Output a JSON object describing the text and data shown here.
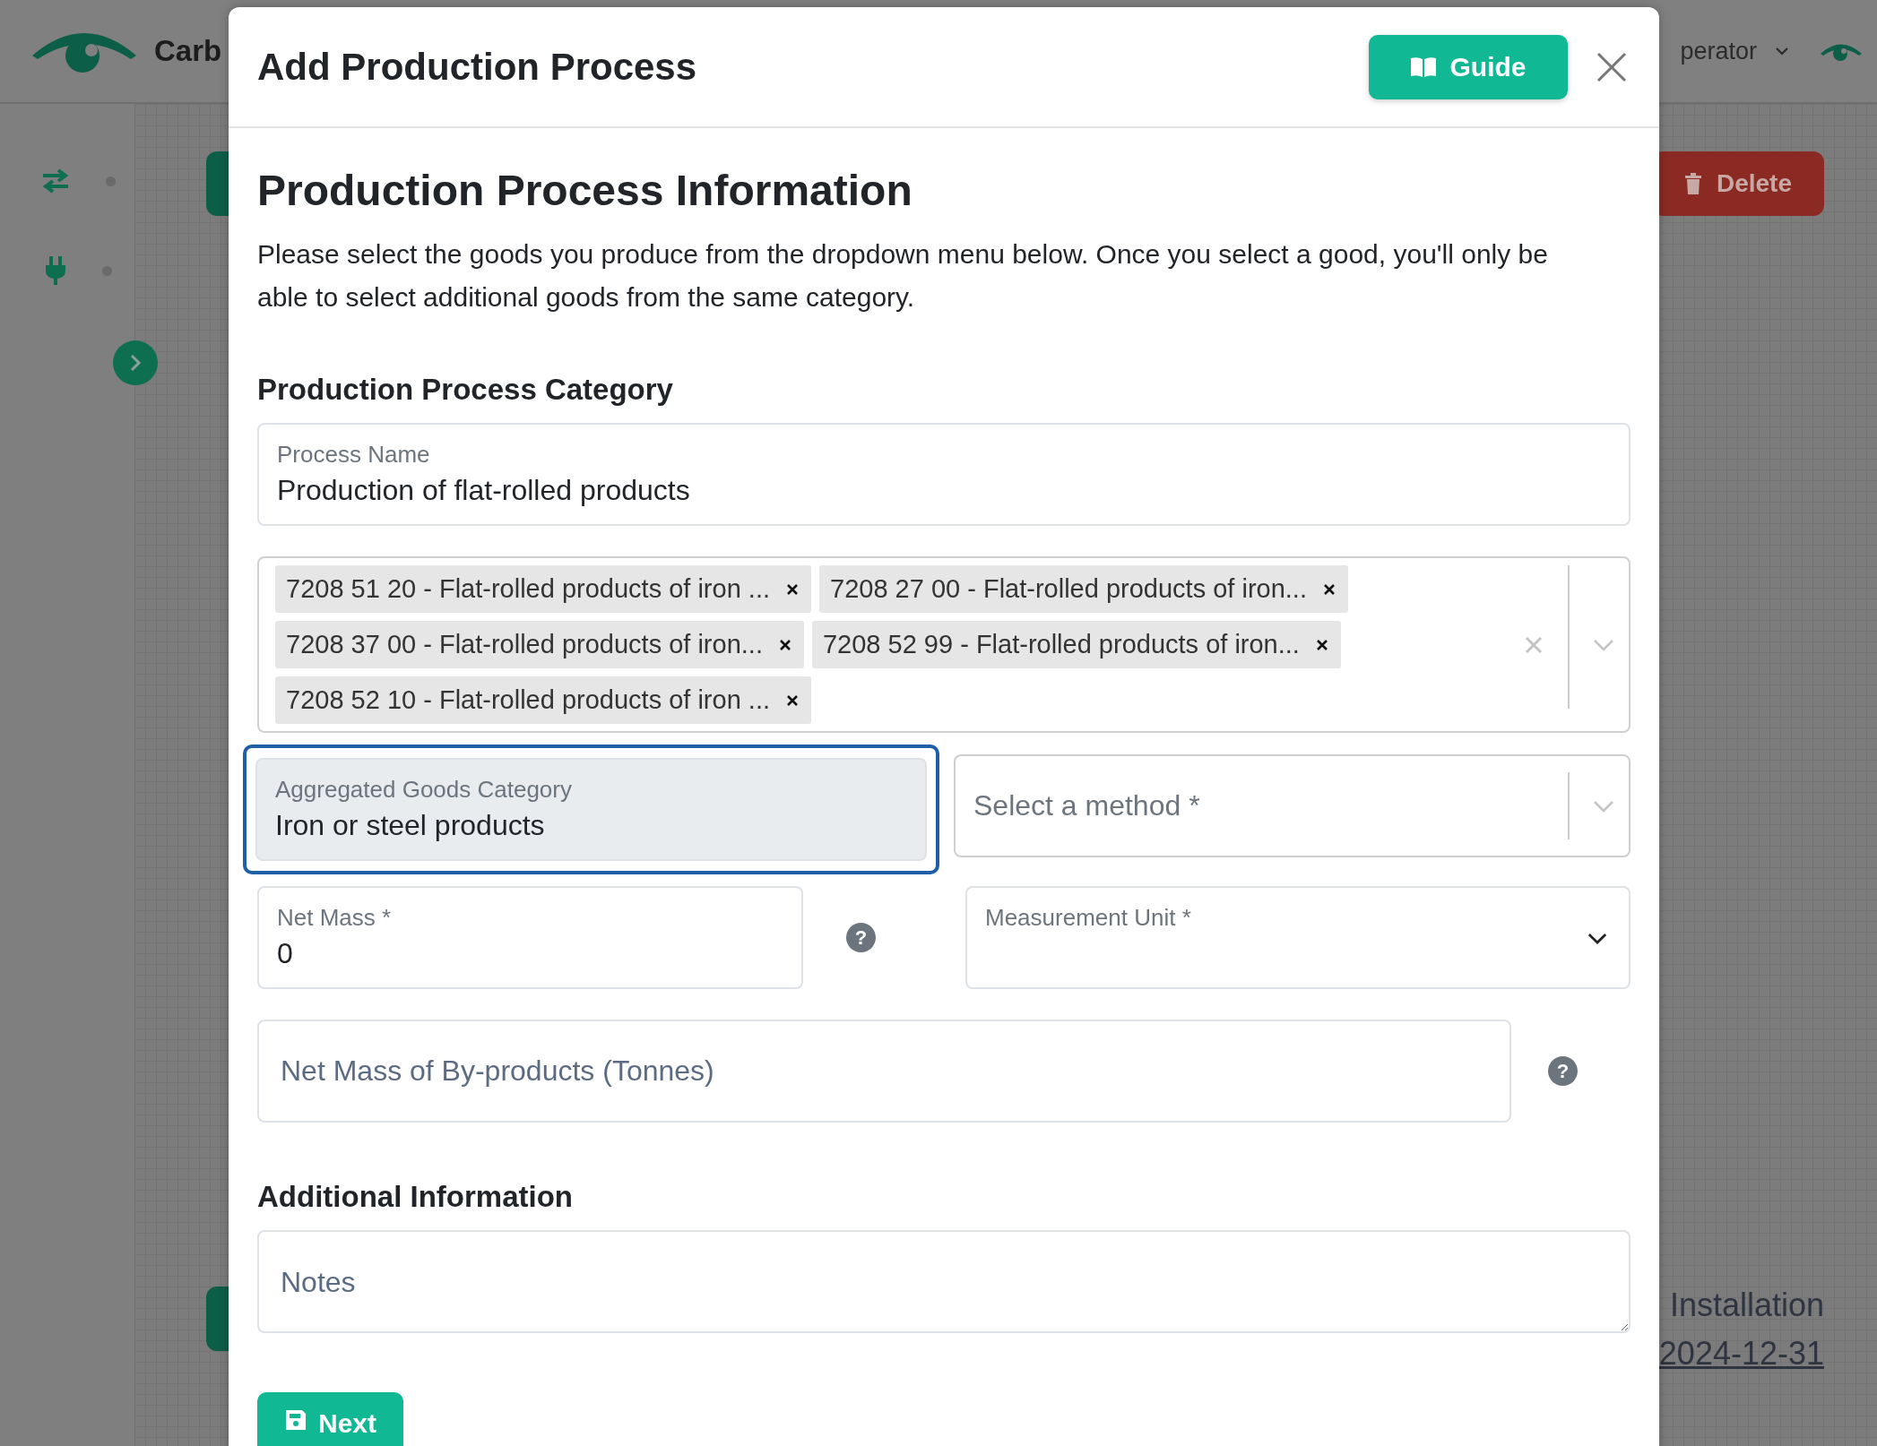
{
  "background": {
    "brand": "Carb",
    "user_menu": "perator",
    "delete_button": "Delete",
    "installation_label": "Installation",
    "installation_date": "2024-12-31"
  },
  "modal": {
    "title": "Add Production Process",
    "guide_button": "Guide",
    "section_title": "Production Process Information",
    "intro": "Please select the goods you produce from the dropdown menu below. Once you select a good, you'll only be able to select additional goods from the same category.",
    "category_heading": "Production Process Category",
    "process_name": {
      "label": "Process Name",
      "value": "Production of flat-rolled products"
    },
    "goods": {
      "tags": [
        {
          "label": "7208 51 20 - Flat-rolled products of iron ..."
        },
        {
          "label": "7208 27 00 - Flat-rolled products of iron..."
        },
        {
          "label": "7208 37 00 - Flat-rolled products of iron..."
        },
        {
          "label": "7208 52 99 - Flat-rolled products of iron..."
        },
        {
          "label": "7208 52 10 - Flat-rolled products of iron ..."
        }
      ]
    },
    "aggregated_category": {
      "label": "Aggregated Goods Category",
      "value": "Iron or steel products",
      "disabled": true,
      "focused": true
    },
    "method_select": {
      "placeholder": "Select a method *"
    },
    "net_mass": {
      "label": "Net Mass *",
      "value": "0",
      "help": "?"
    },
    "measurement_unit": {
      "label": "Measurement Unit *"
    },
    "byproducts": {
      "placeholder": "Net Mass of By-products (Tonnes)",
      "help": "?"
    },
    "additional_heading": "Additional Information",
    "notes": {
      "placeholder": "Notes"
    },
    "next_button": "Next"
  }
}
